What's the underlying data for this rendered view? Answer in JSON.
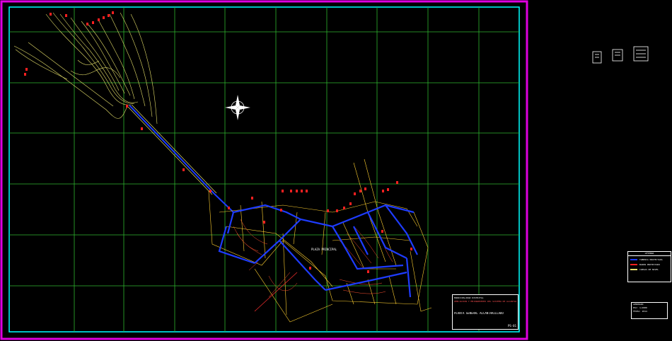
{
  "drawing": {
    "sheet_number": "PS-01",
    "title_block": {
      "institution": "MUNICIPALIDAD DISTRITAL",
      "project": "AMPLIACION Y MEJORAMIENTO DEL SISTEMA DE ALCANTARILLADO",
      "plan_title": "PLANTA GENERAL ALCANTARILLADO"
    },
    "area_label": "PLAZA PRINCIPAL",
    "legend": {
      "title": "LEYENDA",
      "items": [
        {
          "label": "TUBERIA PROYECTADA",
          "color": "#1e3cff"
        },
        {
          "label": "BUZON PROYECTADO",
          "color": "#ff2020"
        },
        {
          "label": "CURVAS DE NIVEL",
          "color": "#e8e070"
        }
      ]
    },
    "stamp": [
      "APROBADO",
      "ESC: 1/2000",
      "FECHA: 2014"
    ]
  },
  "colors": {
    "outer_frame": "#e000e0",
    "inner_frame": "#00ffff",
    "grid": "#2fb52f",
    "contours": "#e6e06a",
    "pipes": "#1e3cff",
    "manholes": "#ff2020",
    "streets": "#ffd030"
  }
}
